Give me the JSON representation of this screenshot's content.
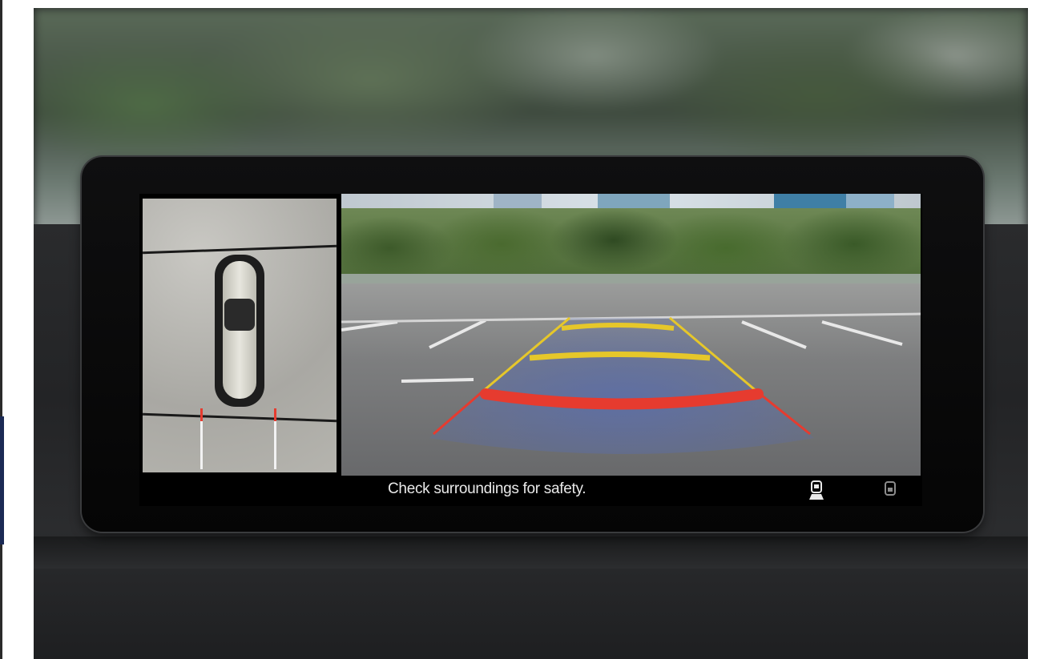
{
  "screen": {
    "message": "Check surroundings for safety."
  },
  "icons": {
    "front_camera": "camera-view-front-icon",
    "rear_camera": "camera-view-rear-icon"
  },
  "colors": {
    "guide_red": "#e63b2f",
    "guide_yellow": "#e6c72a",
    "guide_zone": "#6d7fb5"
  }
}
